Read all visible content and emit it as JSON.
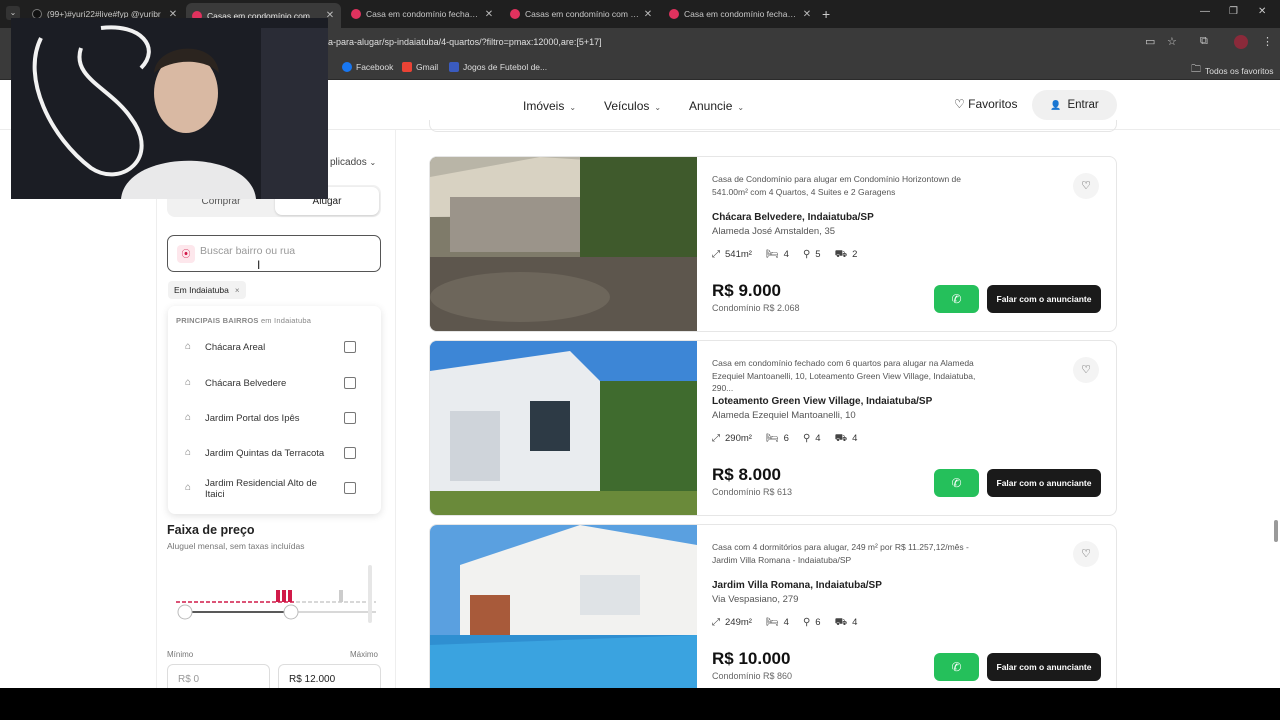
{
  "browser": {
    "tabs": [
      {
        "label": "(99+)#yuri22#live#fyp @yuribr",
        "active": false
      },
      {
        "label": "Casas em condomínio com pisc",
        "active": true
      },
      {
        "label": "Casa em condomínio fechado c",
        "active": false
      },
      {
        "label": "Casas em condomínio com 4 q",
        "active": false
      },
      {
        "label": "Casa em condomínio fechado c",
        "active": false
      }
    ],
    "new_tab": "+",
    "url": "ena-para-alugar/sp-indaiatuba/4-quartos/?filtro=pmax:12000,are:[5+17]",
    "bookmarks": [
      "Facebook",
      "Gmail",
      "Jogos de Futebol de..."
    ],
    "all_bookmarks": "Todos os favoritos"
  },
  "nav": {
    "items": [
      "Imóveis",
      "Veículos",
      "Anuncie"
    ],
    "favoritos": "Favoritos",
    "entrar": "Entrar"
  },
  "filters": {
    "applied_label": "plicados",
    "mode": {
      "buy": "Comprar",
      "rent": "Alugar"
    },
    "search_placeholder": "Buscar bairro ou rua",
    "chip": "Em Indaiatuba",
    "dropdown_head": "PRINCIPAIS BAIRROS",
    "dropdown_head_sub": "em Indaiatuba",
    "neighborhoods": [
      "Chácara Areal",
      "Chácara Belvedere",
      "Jardim Portal dos Ipês",
      "Jardim Quintas da Terracota",
      "Jardim Residencial Alto de Itaici"
    ],
    "price_title": "Faixa de preço",
    "price_sub": "Aluguel mensal, sem taxas incluídas",
    "min_label": "Mínimo",
    "max_label": "Máximo",
    "min_placeholder": "R$ 0",
    "max_value": "R$ 12.000"
  },
  "listings": [
    {
      "desc": "Casa de Condomínio para alugar em Condomínio Horizontown de 541.00m² com 4 Quartos, 4 Suites e 2 Garagens",
      "location": "Chácara Belvedere, Indaiatuba/SP",
      "address": "Alameda José Amstalden, 35",
      "area": "541m²",
      "beds": "4",
      "baths": "5",
      "cars": "2",
      "price": "R$ 9.000",
      "condo": "Condomínio R$ 2.068"
    },
    {
      "desc": "Casa em condomínio fechado com 6 quartos para alugar na Alameda Ezequiel Mantoanelli, 10, Loteamento Green View Village, Indaiatuba, 290...",
      "location": "Loteamento Green View Village, Indaiatuba/SP",
      "address": "Alameda Ezequiel Mantoanelli, 10",
      "area": "290m²",
      "beds": "6",
      "baths": "4",
      "cars": "4",
      "price": "R$ 8.000",
      "condo": "Condomínio R$ 613"
    },
    {
      "desc": "Casa com 4 dormitórios para alugar, 249 m² por R$ 11.257,12/mês - Jardim Villa Romana - Indaiatuba/SP",
      "location": "Jardim Villa Romana, Indaiatuba/SP",
      "address": "Via Vespasiano, 279",
      "area": "249m²",
      "beds": "4",
      "baths": "6",
      "cars": "4",
      "price": "R$ 10.000",
      "condo": "Condomínio R$ 860"
    }
  ],
  "contact_label": "Falar com o anunciante",
  "colors": {
    "brand": "#d11a49",
    "whatsapp": "#25c05b",
    "dark_button": "#1a1a1a"
  }
}
